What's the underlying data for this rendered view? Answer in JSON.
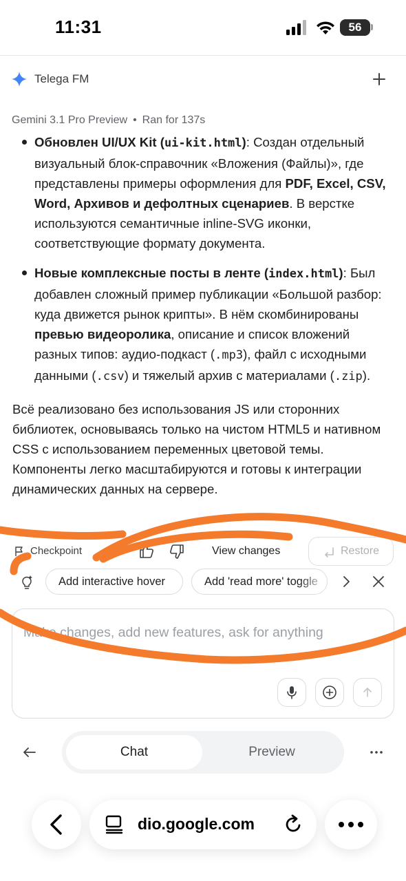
{
  "status_bar": {
    "time": "11:31",
    "battery": "56"
  },
  "header": {
    "title": "Telega FM",
    "sparkle_icon": "sparkle-icon",
    "plus_icon": "plus-icon"
  },
  "meta": {
    "model": "Gemini 3.1 Pro Preview",
    "separator": "•",
    "runtime": "Ran for 137s"
  },
  "content": {
    "bullet1": {
      "b1": "Обновлен UI/UX Kit (",
      "code1": "ui-kit.html",
      "b2": ")",
      "t1": ": Создан отдельный визуальный блок-справочник «Вложения (Файлы)», где представлены примеры оформления для ",
      "b3": "PDF, Excel, CSV, Word, Архивов и дефолтных сценариев",
      "t2": ". В верстке используются семантичные inline-SVG иконки, соответствующие формату документа."
    },
    "bullet2": {
      "b1": "Новые комплексные посты в ленте (",
      "code1": "index.html",
      "b2": ")",
      "t1": ": Был добавлен сложный пример публикации «Большой разбор: куда движется рынок крипты». В нём скомбинированы ",
      "b3": "превью видеоролика",
      "t2": ", описание и список вложений разных типов: аудио-подкаст (",
      "code2": ".mp3",
      "t3": "), файл с исходными данными (",
      "code3": ".csv",
      "t4": ") и тяжелый архив с материалами (",
      "code4": ".zip",
      "t5": ")."
    },
    "paragraph": "Всё реализовано без использования JS или сторонних библиотек, основываясь только на чистом HTML5 и нативном CSS с использованием переменных цветовой темы. Компоненты легко масштабируются и готовы к интеграции динамических данных на сервере."
  },
  "actions": {
    "checkpoint": "Checkpoint",
    "view_changes": "View changes",
    "restore": "Restore"
  },
  "suggestions": {
    "chip1": "Add interactive hover",
    "chip2": "Add 'read more' toggle"
  },
  "input": {
    "placeholder": "Make changes, add new features, ask for anything"
  },
  "tabs": {
    "chat": "Chat",
    "preview": "Preview"
  },
  "browser": {
    "url": "dio.google.com"
  },
  "colors": {
    "annotation": "#f47a2c",
    "accent_sparkle": "#4285f4",
    "text": "#1f1f1f",
    "muted": "#5f6368"
  }
}
